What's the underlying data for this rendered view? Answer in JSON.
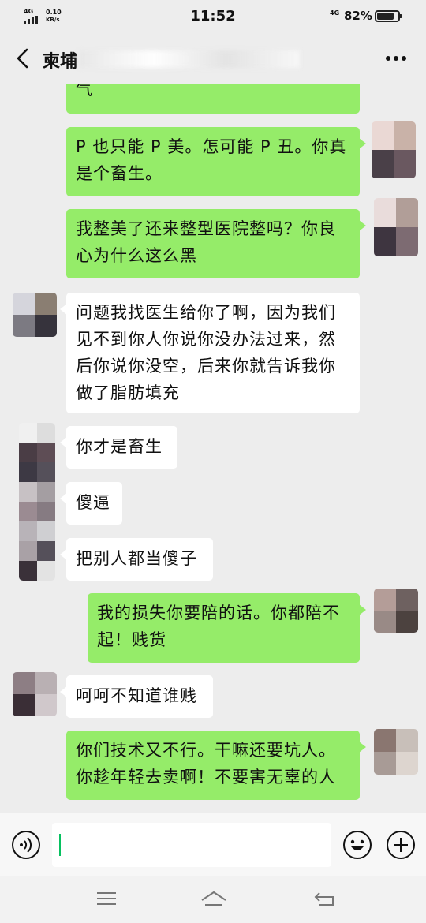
{
  "status_bar": {
    "signal_label": "4G",
    "network_speed_value": "0.10",
    "network_speed_unit": "KB/s",
    "time": "11:52",
    "lte_label": "4G",
    "battery_percent": "82%",
    "battery_level": 0.82
  },
  "header": {
    "title": "柬埔"
  },
  "messages": [
    {
      "side": "out",
      "text": "气"
    },
    {
      "side": "out",
      "text": "P 也只能 P 美。怎可能 P 丑。你真是个畜生。"
    },
    {
      "side": "out",
      "text": "我整美了还来整型医院整吗？你良心为什么这么黑"
    },
    {
      "side": "in",
      "text": "问题我找医生给你了啊，因为我们见不到你人你说你没办法过来，然后你说你没空，后来你就告诉我你做了脂肪填充"
    },
    {
      "side": "in",
      "text": "你才是畜生"
    },
    {
      "side": "in",
      "text": "傻逼"
    },
    {
      "side": "in",
      "text": "把别人都当傻子"
    },
    {
      "side": "out",
      "text": "我的损失你要陪的话。你都陪不起！贱货"
    },
    {
      "side": "in",
      "text": "呵呵不知道谁贱"
    },
    {
      "side": "out",
      "text": "你们技术又不行。干嘛还要坑人。你趁年轻去卖啊！不要害无辜的人"
    }
  ],
  "input_bar": {
    "voice_icon": "voice-icon",
    "emoji_icon": "emoji-icon",
    "plus_icon": "plus-icon"
  },
  "colors": {
    "outgoing_bubble": "#95ec69",
    "incoming_bubble": "#ffffff",
    "background": "#ededed",
    "caret": "#07c160"
  }
}
